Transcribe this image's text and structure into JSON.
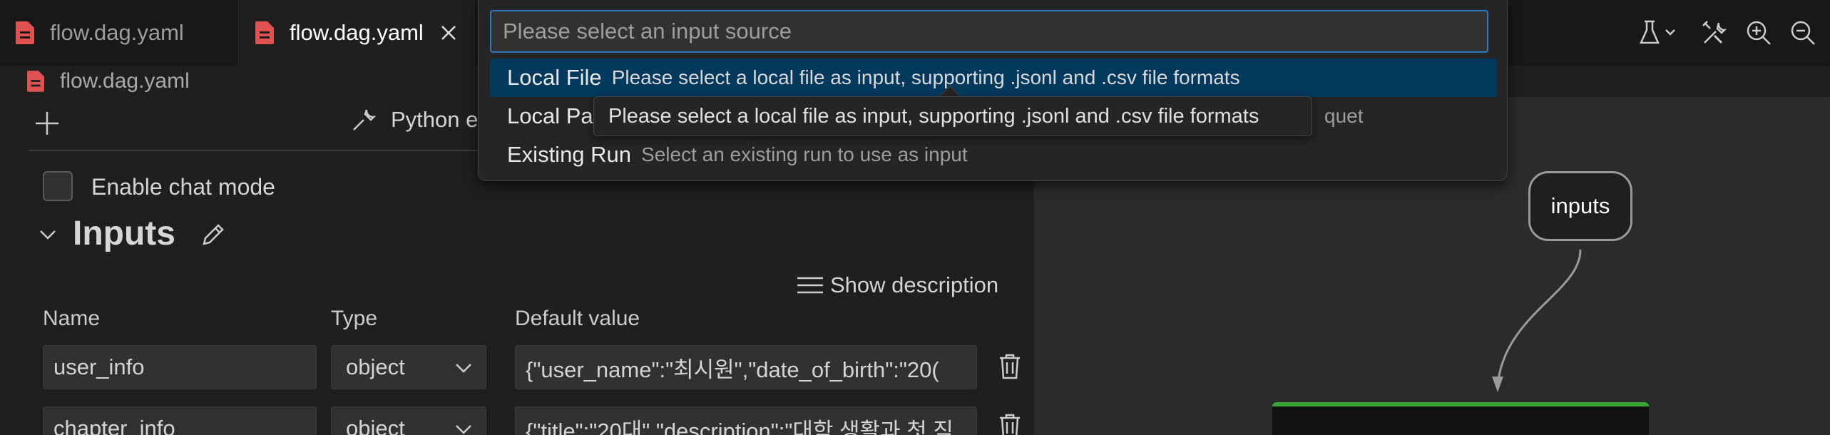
{
  "tabs": [
    {
      "label": "flow.dag.yaml",
      "active": false
    },
    {
      "label": "flow.dag.yaml",
      "active": true
    }
  ],
  "breadcrumb": {
    "label": "flow.dag.yaml"
  },
  "toolbar": {
    "icons": [
      "beaker-icon",
      "chevron-down-icon",
      "tools-icon",
      "zoom-in-icon",
      "zoom-out-icon"
    ]
  },
  "editor": {
    "python_env_label": "Python e",
    "chat_mode_label": "Enable chat mode",
    "inputs_title": "Inputs",
    "show_description_label": "Show description",
    "columns": {
      "name": "Name",
      "type": "Type",
      "default": "Default value"
    },
    "rows": [
      {
        "name": "user_info",
        "type": "object",
        "default": "{\"user_name\":\"최시원\",\"date_of_birth\":\"20("
      },
      {
        "name": "chapter_info",
        "type": "object",
        "default": "{\"title\":\"20대\",\"description\":\"대학 생활과 첫 직"
      }
    ]
  },
  "quickpick": {
    "placeholder": "Please select an input source",
    "items": [
      {
        "label": "Local File",
        "description": "Please select a local file as input, supporting .jsonl and .csv file formats",
        "selected": true
      },
      {
        "label": "Local Pa",
        "description": "quet",
        "selected": false
      },
      {
        "label": "Existing Run",
        "description": "Select an existing run to use as input",
        "selected": false
      }
    ],
    "tooltip": "Please select a local file as input, supporting .jsonl and .csv file formats"
  },
  "graph": {
    "node_label": "inputs"
  },
  "colors": {
    "accent": "#2f7ac6",
    "selection": "#04395e",
    "node_green": "#3aa534",
    "file_icon": "#e05252"
  }
}
